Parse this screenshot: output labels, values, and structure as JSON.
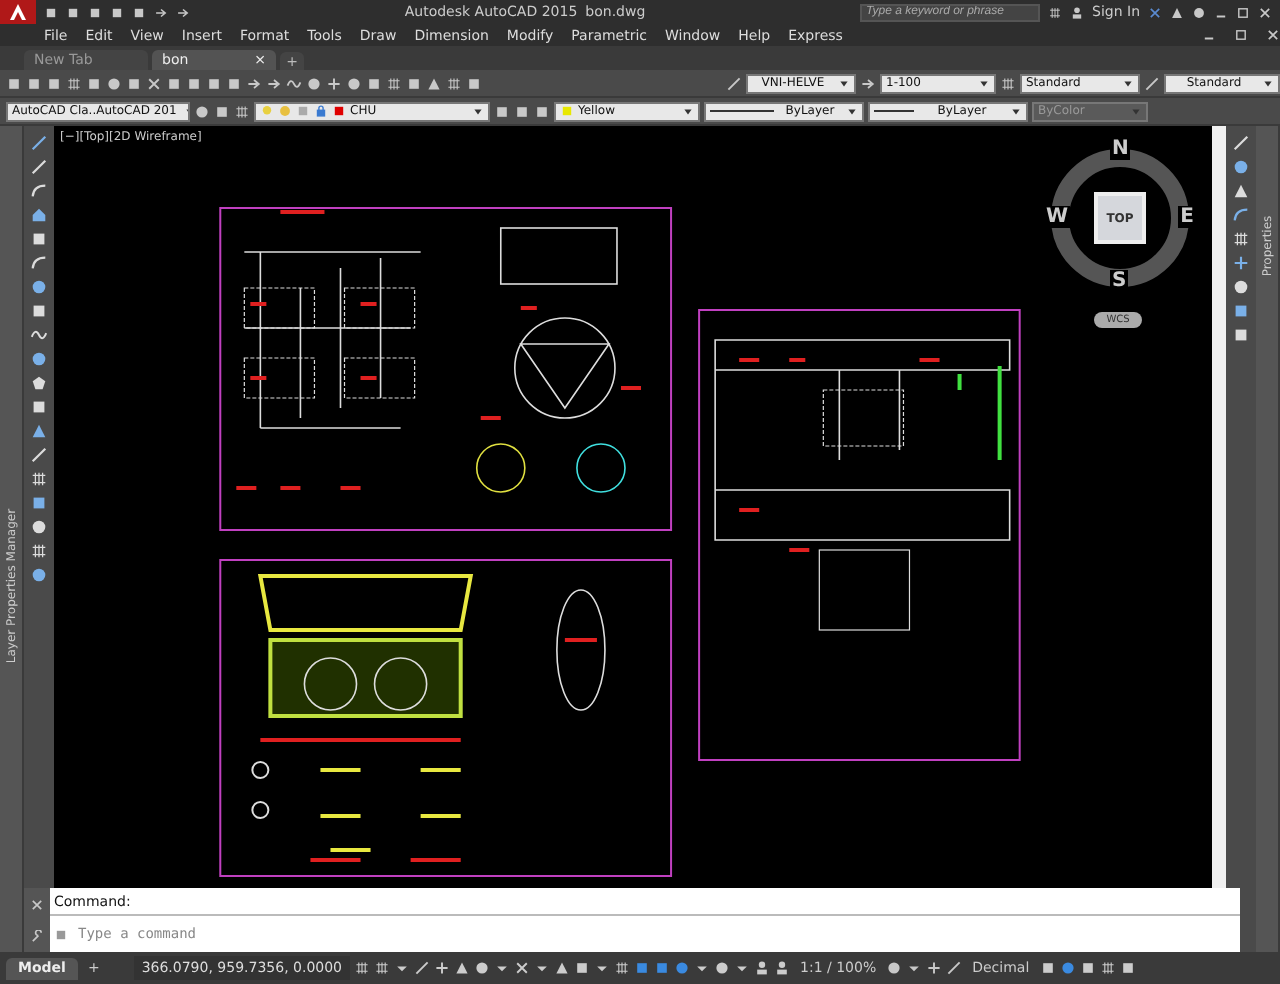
{
  "title_bar": {
    "title": "Autodesk AutoCAD 2015",
    "file": "bon.dwg",
    "search_placeholder": "Type a keyword or phrase",
    "sign_in": "Sign In"
  },
  "menu": [
    "File",
    "Edit",
    "View",
    "Insert",
    "Format",
    "Tools",
    "Draw",
    "Dimension",
    "Modify",
    "Parametric",
    "Window",
    "Help",
    "Express"
  ],
  "tabs": [
    {
      "label": "New Tab",
      "selected": false
    },
    {
      "label": "bon",
      "selected": true,
      "close": "×"
    }
  ],
  "new_tab": "+",
  "styles_toolbar": {
    "text_style": "VNI-HELVE",
    "dim_style": "1-100",
    "table_style": "Standard",
    "multileader_style": "Standard"
  },
  "layers_toolbar": {
    "workspace": "AutoCAD Cla..AutoCAD 201",
    "layer": "CHU",
    "color_control": "Yellow",
    "linetype": "ByLayer",
    "lineweight": "ByLayer",
    "plot_style": "ByColor",
    "plot_style_disabled": true
  },
  "viewport": {
    "label": "[−][Top][2D Wireframe]"
  },
  "viewcube": {
    "north": "N",
    "west": "W",
    "east": "E",
    "south": "S",
    "face": "TOP",
    "ucs": "WCS"
  },
  "palettes": {
    "left": "Layer Properties Manager",
    "right": "Properties"
  },
  "command": {
    "history": "Command:",
    "placeholder": "Type a command"
  },
  "status_bar": {
    "model_tab": "Model",
    "add_layout": "+",
    "coordinates": "366.0790, 959.7356, 0.0000",
    "annotation_scale": "1:1 / 100%",
    "units": "Decimal"
  }
}
